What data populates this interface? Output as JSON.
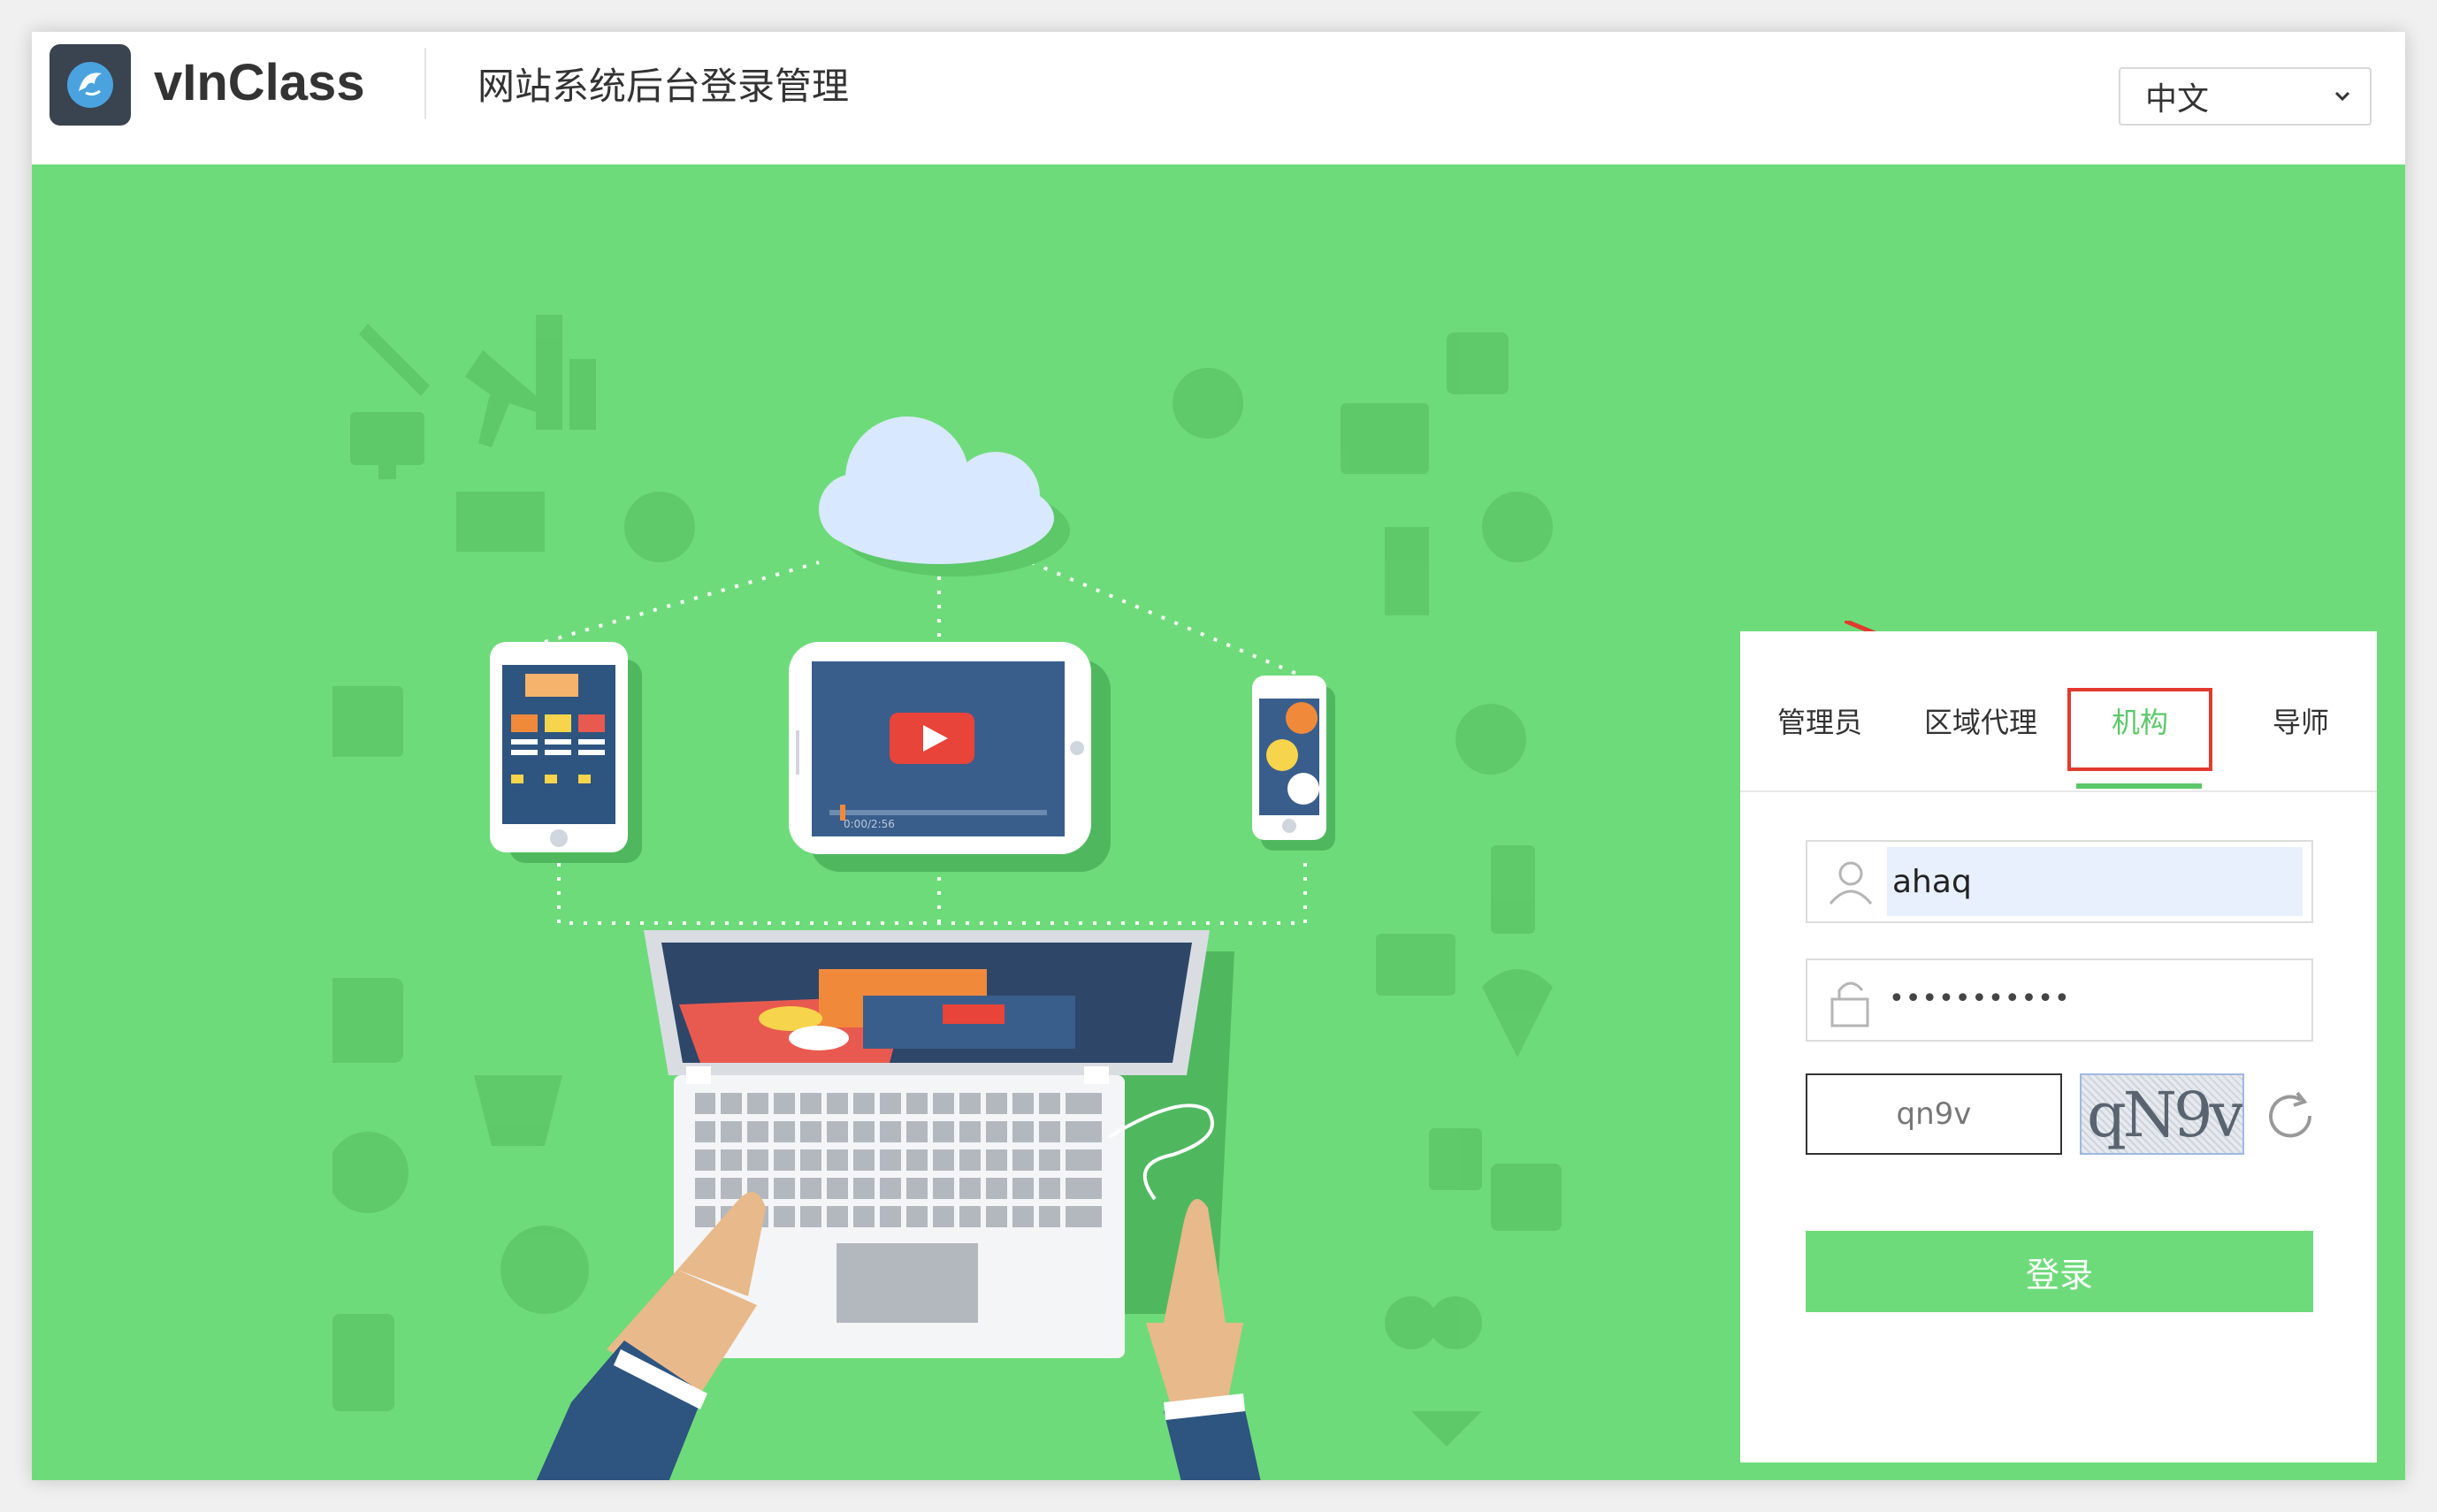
{
  "header": {
    "brand": "vInClass",
    "title": "网站系统后台登录管理",
    "language": "中文"
  },
  "login": {
    "tabs": [
      {
        "label": "管理员"
      },
      {
        "label": "区域代理"
      },
      {
        "label": "机构"
      },
      {
        "label": "导师"
      }
    ],
    "active_tab": "机构",
    "username": "ahaq",
    "password_mask": "•••••••••••",
    "captcha_input": "qn9v",
    "captcha_image_text": "qN9v",
    "submit_label": "登录"
  },
  "illustration": {
    "video_time": "0:00/2:56"
  },
  "colors": {
    "accent_green": "#6edb7a",
    "active_tab_green": "#5cc86a",
    "highlight_red": "#e13b2e"
  }
}
